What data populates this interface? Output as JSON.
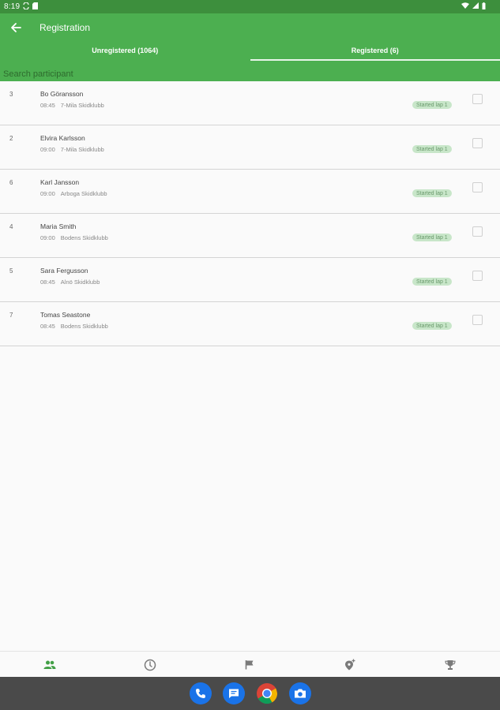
{
  "status_bar": {
    "time": "8:19"
  },
  "app_bar": {
    "title": "Registration"
  },
  "tabs": [
    {
      "label": "Unregistered (1064)",
      "active": false
    },
    {
      "label": "Registered (6)",
      "active": true
    }
  ],
  "search": {
    "placeholder": "Search participant",
    "value": ""
  },
  "participants": [
    {
      "number": "3",
      "name": "Bo Göransson",
      "time": "08:45",
      "club": "7-Mila Skidklubb",
      "status": "Started lap 1",
      "checked": false
    },
    {
      "number": "2",
      "name": "Elvira Karlsson",
      "time": "09:00",
      "club": "7-Mila Skidklubb",
      "status": "Started lap 1",
      "checked": false
    },
    {
      "number": "6",
      "name": "Karl Jansson",
      "time": "09:00",
      "club": "Arboga Skidklubb",
      "status": "Started lap 1",
      "checked": false
    },
    {
      "number": "4",
      "name": "Maria Smith",
      "time": "09:00",
      "club": "Bodens Skidklubb",
      "status": "Started lap 1",
      "checked": false
    },
    {
      "number": "5",
      "name": "Sara Fergusson",
      "time": "08:45",
      "club": "Alnö Skidklubb",
      "status": "Started lap 1",
      "checked": false
    },
    {
      "number": "7",
      "name": "Tomas Seastone",
      "time": "08:45",
      "club": "Bodens Skidklubb",
      "status": "Started lap 1",
      "checked": false
    }
  ],
  "bottom_nav": [
    {
      "icon": "people-icon",
      "active": true
    },
    {
      "icon": "timer-icon",
      "active": false
    },
    {
      "icon": "flag-icon",
      "active": false
    },
    {
      "icon": "add-location-icon",
      "active": false
    },
    {
      "icon": "trophy-icon",
      "active": false
    }
  ],
  "dock": [
    {
      "icon": "phone-icon",
      "color": "#1a73e8"
    },
    {
      "icon": "messages-icon",
      "color": "#1a73e8"
    },
    {
      "icon": "chrome-icon",
      "color": "#ffffff"
    },
    {
      "icon": "camera-icon",
      "color": "#1a73e8"
    }
  ],
  "colors": {
    "primary": "#4caf50",
    "status_bar": "#3d8f3d",
    "badge_bg": "#c8e6c9",
    "nav_active": "#43a047",
    "nav_inactive": "#7a7a7a"
  }
}
